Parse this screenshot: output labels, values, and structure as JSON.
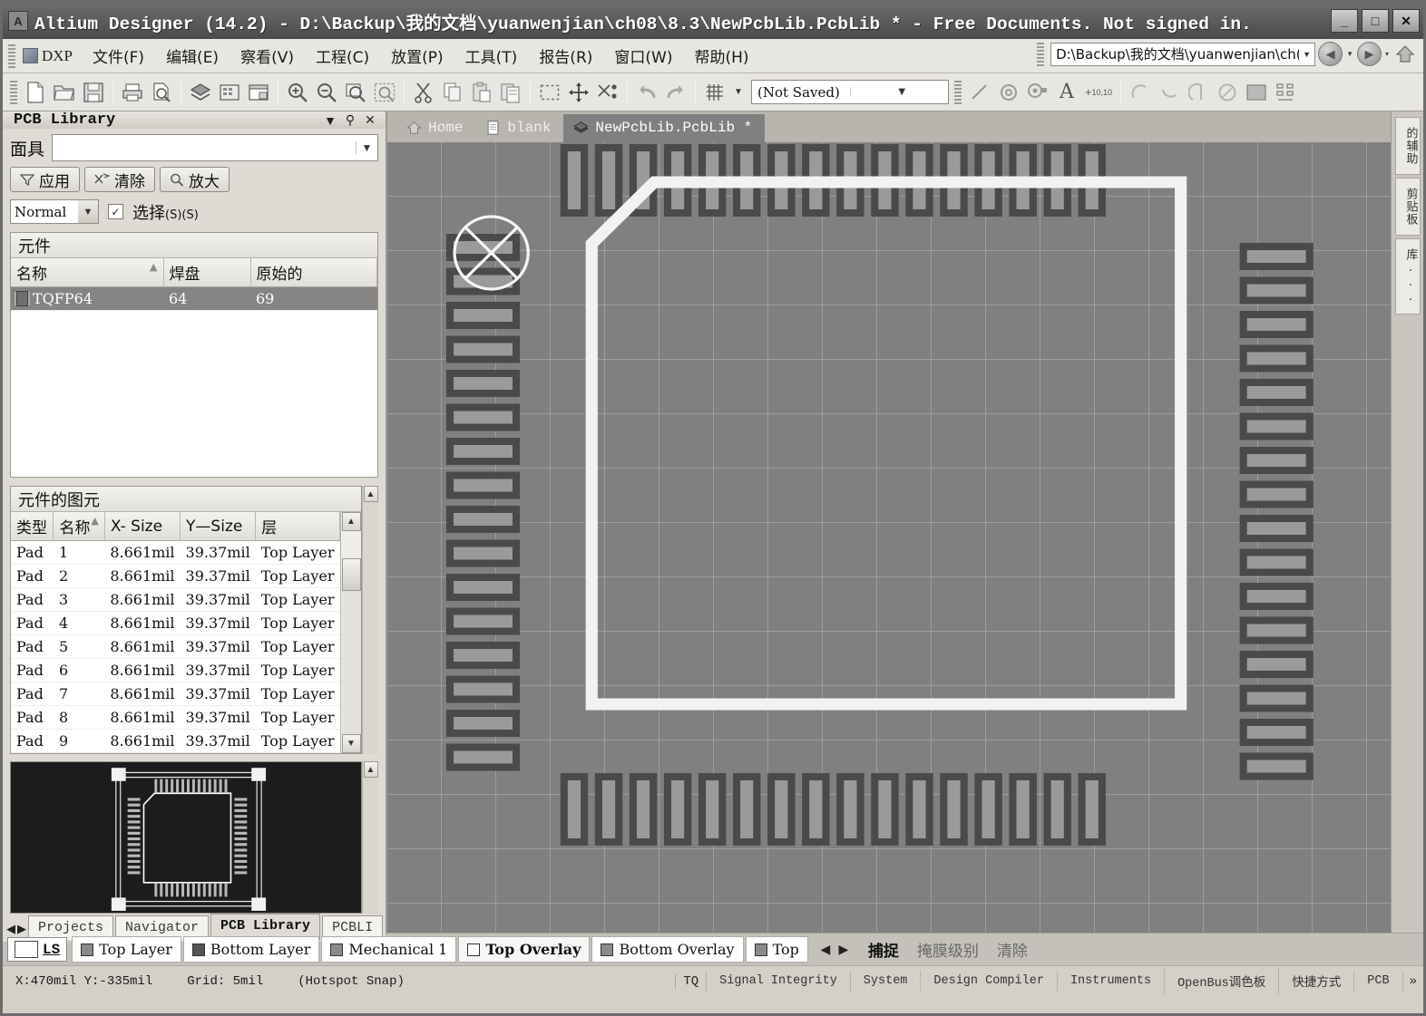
{
  "window": {
    "title": "Altium Designer (14.2) - D:\\Backup\\我的文档\\yuanwenjian\\ch08\\8.3\\NewPcbLib.PcbLib * - Free Documents. Not signed in.",
    "app_icon": "A",
    "minimize": "_",
    "maximize": "□",
    "close": "✕"
  },
  "menu": {
    "dxp_label": "DXP",
    "items": [
      {
        "label": "文件(F)"
      },
      {
        "label": "编辑(E)"
      },
      {
        "label": "察看(V)"
      },
      {
        "label": "工程(C)"
      },
      {
        "label": "放置(P)"
      },
      {
        "label": "工具(T)"
      },
      {
        "label": "报告(R)"
      },
      {
        "label": "窗口(W)"
      },
      {
        "label": "帮助(H)"
      }
    ],
    "address_value": "D:\\Backup\\我的文档\\yuanwenjian\\ch(",
    "back_icon": "◀",
    "forward_icon": "▶",
    "home_icon": "⌂"
  },
  "toolbar": {
    "save_state": "(Not Saved)",
    "icons": [
      "new-document-icon",
      "open-folder-icon",
      "save-icon",
      "print-icon",
      "print-preview-icon",
      "board-layers-icon",
      "library-icon",
      "panels-icon",
      "zoom-in-icon",
      "zoom-out-icon",
      "zoom-area-icon",
      "zoom-selected-icon",
      "cut-icon",
      "copy-icon",
      "paste-icon",
      "paste-special-icon",
      "select-rect-icon",
      "move-icon",
      "cross-probe-icon",
      "undo-icon",
      "redo-icon",
      "grid-icon"
    ],
    "draw_icons": [
      "line-icon",
      "via-icon",
      "pad-icon",
      "text-icon",
      "coordinate-icon",
      "arc-center-icon",
      "arc-edge-icon",
      "arc-any-icon",
      "full-circle-icon",
      "fill-icon",
      "component-body-icon"
    ]
  },
  "left_panel": {
    "title": "PCB Library",
    "header_buttons": [
      "dropdown-icon",
      "pin-icon",
      "close-icon"
    ],
    "mask": {
      "label": "面具",
      "value": "",
      "placeholder": ""
    },
    "buttons": [
      {
        "label": "应用",
        "icon": "filter-icon"
      },
      {
        "label": "清除",
        "icon": "clear-filter-icon"
      },
      {
        "label": "放大",
        "icon": "magnify-icon"
      }
    ],
    "mode": "Normal",
    "select_checkbox": {
      "checked": true,
      "label": "选择",
      "hint1": "(S)",
      "hint2": "(S)"
    },
    "components": {
      "caption": "元件",
      "columns": [
        "名称",
        "焊盘",
        "原始的"
      ],
      "sort_marker": "▲",
      "rows": [
        {
          "name": "TQFP64",
          "pads": "64",
          "primitives": "69",
          "selected": true
        }
      ]
    },
    "primitives": {
      "caption": "元件的图元",
      "columns": [
        "类型",
        "名称",
        "X- Size",
        "Y—Size",
        "层"
      ],
      "sort_marker": "▲",
      "rows": [
        {
          "type": "Pad",
          "name": "1",
          "x": "8.661mil",
          "y": "39.37mil",
          "layer": "Top Layer"
        },
        {
          "type": "Pad",
          "name": "2",
          "x": "8.661mil",
          "y": "39.37mil",
          "layer": "Top Layer"
        },
        {
          "type": "Pad",
          "name": "3",
          "x": "8.661mil",
          "y": "39.37mil",
          "layer": "Top Layer"
        },
        {
          "type": "Pad",
          "name": "4",
          "x": "8.661mil",
          "y": "39.37mil",
          "layer": "Top Layer"
        },
        {
          "type": "Pad",
          "name": "5",
          "x": "8.661mil",
          "y": "39.37mil",
          "layer": "Top Layer"
        },
        {
          "type": "Pad",
          "name": "6",
          "x": "8.661mil",
          "y": "39.37mil",
          "layer": "Top Layer"
        },
        {
          "type": "Pad",
          "name": "7",
          "x": "8.661mil",
          "y": "39.37mil",
          "layer": "Top Layer"
        },
        {
          "type": "Pad",
          "name": "8",
          "x": "8.661mil",
          "y": "39.37mil",
          "layer": "Top Layer"
        },
        {
          "type": "Pad",
          "name": "9",
          "x": "8.661mil",
          "y": "39.37mil",
          "layer": "Top Layer"
        }
      ]
    },
    "preview_alt": "TQFP64 footprint preview",
    "tabs": [
      {
        "label": "Projects",
        "active": false
      },
      {
        "label": "Navigator",
        "active": false
      },
      {
        "label": "PCB Library",
        "active": true
      },
      {
        "label": "PCBLI",
        "active": false
      }
    ],
    "tab_arrows": [
      "◀",
      "▶"
    ]
  },
  "doc_tabs": [
    {
      "label": "Home",
      "icon": "home-icon",
      "active": false
    },
    {
      "label": "blank",
      "icon": "document-icon",
      "active": false
    },
    {
      "label": "NewPcbLib.PcbLib *",
      "icon": "pcblib-icon",
      "active": true
    }
  ],
  "right_tabs": [
    {
      "label": "的辅助"
    },
    {
      "label": "剪贴板"
    },
    {
      "label": "库..."
    }
  ],
  "canvas": {
    "footprint": "TQFP64",
    "pads_per_side": 16,
    "pin1_marker": "pin-1-marker"
  },
  "layer_bar": {
    "ls_label": "LS",
    "layers": [
      {
        "label": "Top Layer",
        "color": "#8a8a8a",
        "current": false
      },
      {
        "label": "Bottom Layer",
        "color": "#555555",
        "current": false
      },
      {
        "label": "Mechanical 1",
        "color": "#8a8a8a",
        "current": false
      },
      {
        "label": "Top Overlay",
        "color": "#ffffff",
        "current": true
      },
      {
        "label": "Bottom Overlay",
        "color": "#8a8a8a",
        "current": false
      },
      {
        "label": "Top",
        "color": "#8a8a8a",
        "current": false
      }
    ],
    "arrows": [
      "◀",
      "▶"
    ],
    "actions": [
      {
        "label": "捕捉",
        "active": true
      },
      {
        "label": "掩膜级别",
        "active": false
      },
      {
        "label": "清除",
        "active": false
      }
    ]
  },
  "status_bar": {
    "coords": "X:470mil Y:-335mil",
    "grid": "Grid: 5mil",
    "snap": "(Hotspot Snap)",
    "doc_tag": "TQ",
    "panels": [
      "Signal Integrity",
      "System",
      "Design Compiler",
      "Instruments",
      "OpenBus调色板",
      "快捷方式",
      "PCB"
    ],
    "more": "»"
  }
}
